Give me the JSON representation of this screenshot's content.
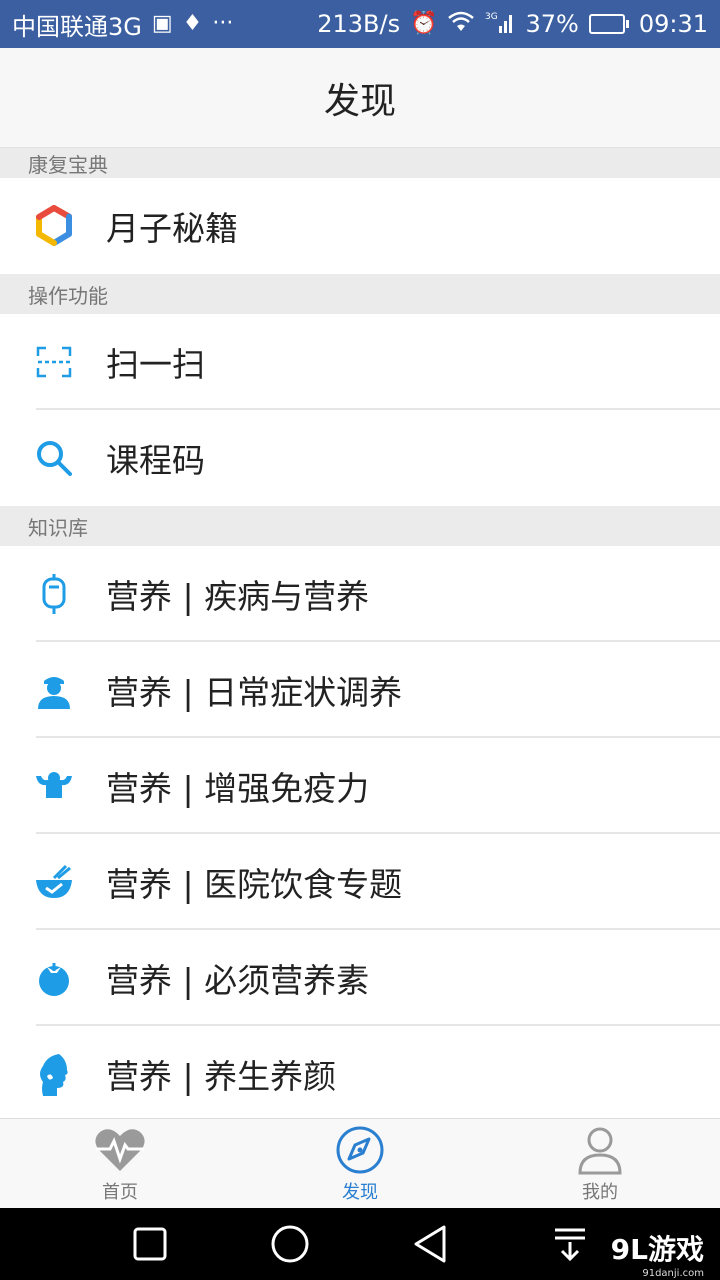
{
  "status_bar": {
    "carrier": "中国联通3G",
    "speed": "213B/s",
    "network": "3G",
    "battery": "37%",
    "battery_level": 0.37,
    "time": "09:31"
  },
  "header": {
    "title": "发现"
  },
  "sections": [
    {
      "title": "康复宝典",
      "items": [
        {
          "label": "月子秘籍",
          "icon": "hexagon-logo-icon"
        }
      ]
    },
    {
      "title": "操作功能",
      "items": [
        {
          "label": "扫一扫",
          "icon": "scan-icon"
        },
        {
          "label": "课程码",
          "icon": "search-icon"
        }
      ]
    },
    {
      "title": "知识库",
      "items": [
        {
          "label": "营养 | 疾病与营养",
          "icon": "iv-drip-icon"
        },
        {
          "label": "营养 | 日常症状调养",
          "icon": "nurse-icon"
        },
        {
          "label": "营养 | 增强免疫力",
          "icon": "strong-person-icon"
        },
        {
          "label": "营养 | 医院饮食专题",
          "icon": "food-bowl-icon"
        },
        {
          "label": "营养 | 必须营养素",
          "icon": "tomato-icon"
        },
        {
          "label": "营养 | 养生养颜",
          "icon": "face-profile-icon"
        }
      ]
    }
  ],
  "tabs": [
    {
      "label": "首页",
      "icon": "heartbeat-icon",
      "active": false
    },
    {
      "label": "发现",
      "icon": "compass-icon",
      "active": true
    },
    {
      "label": "我的",
      "icon": "user-icon",
      "active": false
    }
  ],
  "watermark": {
    "text": "9L游戏",
    "sub": "91danji.com"
  },
  "colors": {
    "accent": "#2a7fd0",
    "icon_blue": "#1e9ce6",
    "status_bar": "#3b5fa0"
  }
}
